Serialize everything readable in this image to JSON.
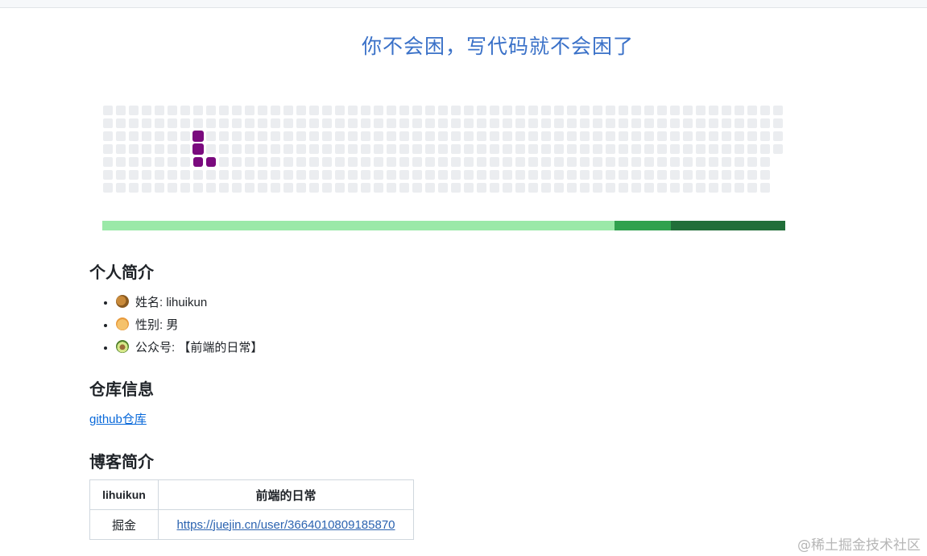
{
  "title": "你不会困，写代码就不会困了",
  "snake_grid": {
    "columns": 53,
    "rows": 7,
    "last_column_rows": 4,
    "snake_color": "#7a0a7e",
    "empty_color": "#ebedf0"
  },
  "progress_colors": [
    "#9be9a8",
    "#30a14e",
    "#216e39"
  ],
  "progress_fractions": [
    0.75,
    0.083,
    0.167
  ],
  "profile": {
    "heading": "个人简介",
    "items": [
      {
        "icon": "monkey-icon",
        "text": "姓名: lihuikun"
      },
      {
        "icon": "child-icon",
        "text": "性别: 男"
      },
      {
        "icon": "avocado-icon",
        "text": "公众号: 【前端的日常】"
      }
    ]
  },
  "repo": {
    "heading": "仓库信息",
    "link_text": "github仓库"
  },
  "blog": {
    "heading": "博客简介",
    "headers": [
      "lihuikun",
      "前端的日常"
    ],
    "rows": [
      {
        "site": "掘金",
        "url": "https://juejin.cn/user/3664010809185870"
      }
    ]
  },
  "watermark": "@稀土掘金技术社区"
}
